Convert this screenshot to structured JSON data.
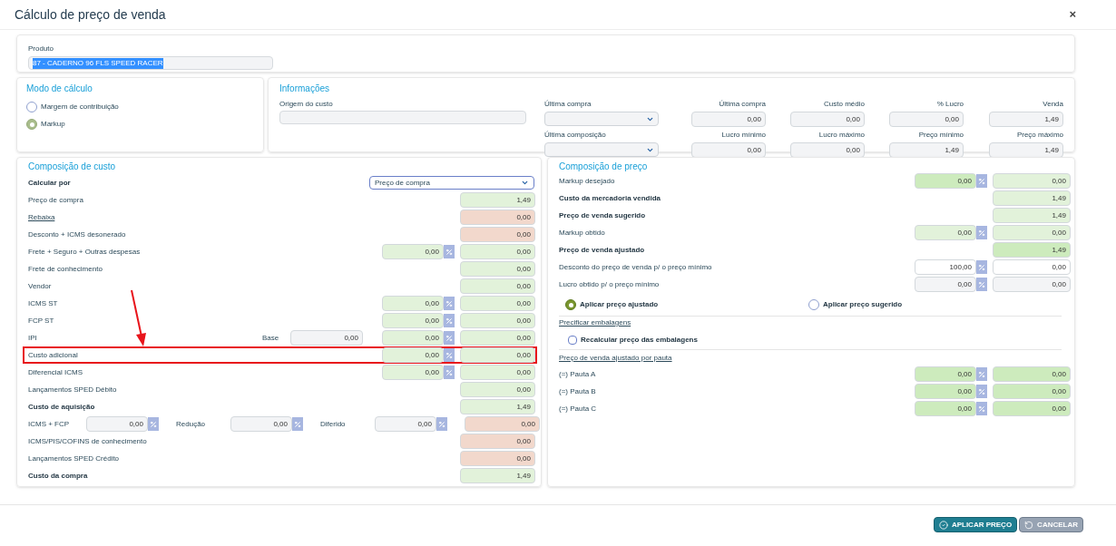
{
  "window": {
    "title": "Cálculo de preço de venda",
    "close": "×"
  },
  "product": {
    "label": "Produto",
    "value": "87 - CADERNO 96 FLS SPEED RACER",
    "text_selected": true
  },
  "mode": {
    "title": "Modo de cálculo",
    "options": [
      {
        "label": "Margem de contribuição",
        "selected": false
      },
      {
        "label": "Markup",
        "selected": true
      }
    ]
  },
  "info": {
    "title": "Informações",
    "origin": {
      "label": "Origem do custo"
    },
    "rows": [
      [
        {
          "kind": "select",
          "label": "Última compra"
        },
        {
          "kind": "field",
          "label": "Última compra",
          "value": "0,00"
        },
        {
          "kind": "field",
          "label": "Custo médio",
          "value": "0,00"
        },
        {
          "kind": "field",
          "label": "% Lucro",
          "value": "0,00"
        },
        {
          "kind": "field",
          "label": "Venda",
          "value": "1,49"
        }
      ],
      [
        {
          "kind": "select",
          "label": "Última composição"
        },
        {
          "kind": "field",
          "label": "Lucro mínimo",
          "value": "0,00"
        },
        {
          "kind": "field",
          "label": "Lucro máximo",
          "value": "0,00"
        },
        {
          "kind": "field",
          "label": "Preço mínimo",
          "value": "1,49"
        },
        {
          "kind": "field",
          "label": "Preço máximo",
          "value": "1,49"
        }
      ]
    ]
  },
  "cost": {
    "title": "Composição de custo",
    "rows": [
      {
        "kind": "select",
        "label": "Calcular por",
        "bold": true,
        "select": "Preço de compra"
      },
      {
        "kind": "plain",
        "label": "Preço de compra",
        "value": "1,49",
        "color": "#e2f2da"
      },
      {
        "kind": "link",
        "label": "Rebaixa",
        "value": "0,00",
        "color": "#f2d8cc"
      },
      {
        "kind": "plain",
        "label": "Desconto + ICMS desonerado",
        "value": "0,00",
        "color": "#f2d8cc"
      },
      {
        "kind": "plain",
        "label": "Frete + Seguro + Outras despesas",
        "pct": {
          "value": "0,00",
          "color": "#e2f2da"
        },
        "value": "0,00",
        "color": "#e2f2da"
      },
      {
        "kind": "plain",
        "label": "Frete de conhecimento",
        "value": "0,00",
        "color": "#e2f2da"
      },
      {
        "kind": "plain",
        "label": "Vendor",
        "value": "0,00",
        "color": "#e2f2da"
      },
      {
        "kind": "plain",
        "label": "ICMS ST",
        "pct": {
          "value": "0,00",
          "color": "#e2f2da"
        },
        "value": "0,00",
        "color": "#e2f2da"
      },
      {
        "kind": "plain",
        "label": "FCP ST",
        "pct": {
          "value": "0,00",
          "color": "#e2f2da"
        },
        "value": "0,00",
        "color": "#e2f2da"
      },
      {
        "kind": "plain",
        "label": "IPI",
        "base": {
          "label": "Base",
          "value": "0,00"
        },
        "pct": {
          "value": "0,00",
          "color": "#e2f2da"
        },
        "value": "0,00",
        "color": "#e2f2da"
      },
      {
        "kind": "plain",
        "label": "Custo adicional",
        "highlighted": true,
        "pct": {
          "value": "0,00",
          "color": "#e2f2da"
        },
        "value": "0,00",
        "color": "#e2f2da"
      },
      {
        "kind": "plain",
        "label": "Diferencial ICMS",
        "pct": {
          "value": "0,00",
          "color": "#e2f2da"
        },
        "value": "0,00",
        "color": "#e2f2da"
      },
      {
        "kind": "plain",
        "label": "Lançamentos SPED Débito",
        "value": "0,00",
        "color": "#e2f2da"
      },
      {
        "kind": "plain",
        "label": "Custo de aquisição",
        "bold": true,
        "value": "1,49",
        "color": "#e2f2da"
      },
      {
        "kind": "inline",
        "label": "ICMS + FCP",
        "fields": [
          {
            "value": "0,00"
          },
          {
            "label": "Redução",
            "value": "0,00"
          },
          {
            "label": "Diferido",
            "value": "0,00"
          }
        ],
        "value": "0,00",
        "color": "#f2d8cc"
      },
      {
        "kind": "plain",
        "label": "ICMS/PIS/COFINS de conhecimento",
        "value": "0,00",
        "color": "#f2d8cc"
      },
      {
        "kind": "plain",
        "label": "Lançamentos SPED Crédito",
        "value": "0,00",
        "color": "#f2d8cc"
      },
      {
        "kind": "plain",
        "label": "Custo da compra",
        "bold": true,
        "value": "1,49",
        "color": "#e2f2da"
      }
    ]
  },
  "price": {
    "title": "Composição de preço",
    "rows": [
      {
        "label": "Markup desejado",
        "pct": {
          "value": "0,00",
          "color": "#cdebbd"
        },
        "value": "0,00",
        "color": "#e2f2da"
      },
      {
        "label": "Custo da mercadoria vendida",
        "bold": true,
        "value": "1,49",
        "color": "#e2f2da"
      },
      {
        "label": "Preço de venda sugerido",
        "bold": true,
        "value": "1,49",
        "color": "#e2f2da"
      },
      {
        "label": "Markup obtido",
        "pct": {
          "value": "0,00",
          "color": "#e2f2da"
        },
        "value": "0,00",
        "color": "#e2f2da"
      },
      {
        "label": "Preço de venda ajustado",
        "bold": true,
        "value": "1,49",
        "color": "#cdebbd"
      },
      {
        "label": "Desconto do preço de venda p/ o preço mínimo",
        "pct": {
          "value": "100,00",
          "color": "#ffffff"
        },
        "value": "0,00",
        "color": "#ffffff"
      },
      {
        "label": "Lucro obtido p/ o preço mínimo",
        "pct": {
          "value": "0,00",
          "color": "#f3f4f6"
        },
        "value": "0,00",
        "color": "#f3f4f6"
      }
    ],
    "apply": [
      {
        "label": "Aplicar preço ajustado",
        "selected": true
      },
      {
        "label": "Aplicar preço sugerido",
        "selected": false
      }
    ],
    "packaging_link": "Precificar embalagens",
    "recalc": {
      "label": "Recalcular preço das embalagens",
      "checked": false
    },
    "pauta_link": "Preço de venda ajustado por pauta",
    "pautas": [
      {
        "label": "(=) Pauta A",
        "pct": {
          "value": "0,00",
          "color": "#cdebbd"
        },
        "value": "0,00",
        "color": "#cdebbd"
      },
      {
        "label": "(=) Pauta B",
        "pct": {
          "value": "0,00",
          "color": "#cdebbd"
        },
        "value": "0,00",
        "color": "#cdebbd"
      },
      {
        "label": "(=) Pauta C",
        "pct": {
          "value": "0,00",
          "color": "#cdebbd"
        },
        "value": "0,00",
        "color": "#cdebbd"
      }
    ]
  },
  "buttons": [
    {
      "kind": "primary",
      "label": "APLICAR PREÇO"
    },
    {
      "kind": "secondary",
      "label": "CANCELAR"
    }
  ]
}
